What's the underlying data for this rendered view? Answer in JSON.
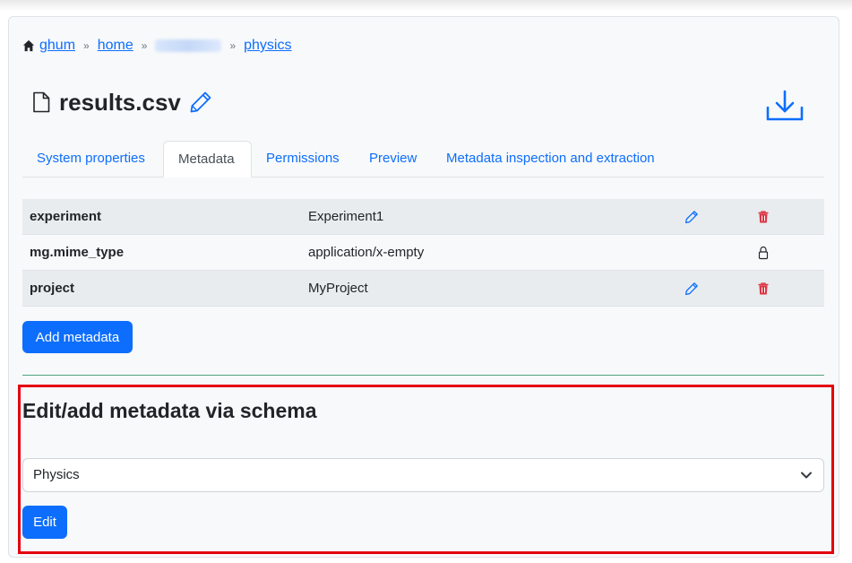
{
  "breadcrumb": {
    "home_icon": "house-icon",
    "items": [
      "ghum",
      "home",
      "physics"
    ],
    "separator": "»"
  },
  "file": {
    "name": "results.csv",
    "icon": "file-icon",
    "rename_icon": "pencil-icon",
    "download_icon": "download-icon"
  },
  "tabs": [
    "System properties",
    "Metadata",
    "Permissions",
    "Preview",
    "Metadata inspection and extraction"
  ],
  "active_tab": "Metadata",
  "metadata": {
    "rows": [
      {
        "key": "experiment",
        "value": "Experiment1",
        "editable": true
      },
      {
        "key": "mg.mime_type",
        "value": "application/x-empty",
        "editable": false
      },
      {
        "key": "project",
        "value": "MyProject",
        "editable": true
      }
    ],
    "add_label": "Add metadata"
  },
  "schema": {
    "title": "Edit/add metadata via schema",
    "selected": "Physics",
    "edit_label": "Edit"
  },
  "colors": {
    "link": "#0d6efd",
    "primary_button": "#0d6efd",
    "delete": "#dc3545",
    "highlight": "#e3000f",
    "divider": "#198754"
  }
}
